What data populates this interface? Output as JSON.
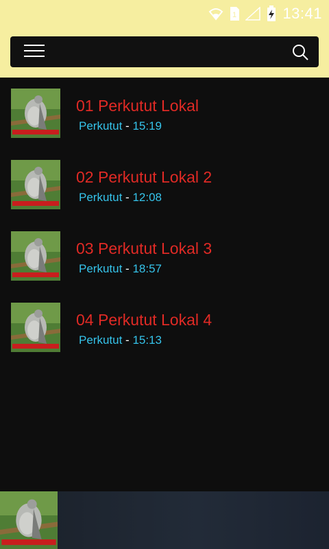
{
  "status": {
    "time": "13:41",
    "icons": [
      "wifi-icon",
      "sim-icon",
      "signal-icon",
      "battery-charging-icon"
    ]
  },
  "appbar": {
    "menu_icon": "hamburger-menu-icon",
    "search_icon": "search-icon"
  },
  "tracks": [
    {
      "title": "01 Perkutut Lokal",
      "artist": "Perkutut",
      "separator": "-",
      "duration": "15:19"
    },
    {
      "title": "02 Perkutut Lokal 2",
      "artist": "Perkutut",
      "separator": "-",
      "duration": "12:08"
    },
    {
      "title": "03 Perkutut Lokal 3",
      "artist": "Perkutut",
      "separator": "-",
      "duration": "18:57"
    },
    {
      "title": "04 Perkutut Lokal 4",
      "artist": "Perkutut",
      "separator": "-",
      "duration": "15:13"
    }
  ],
  "colors": {
    "header_bg": "#f6eea0",
    "title": "#e02a25",
    "meta": "#35c3ea",
    "background": "#0e0e0e"
  }
}
